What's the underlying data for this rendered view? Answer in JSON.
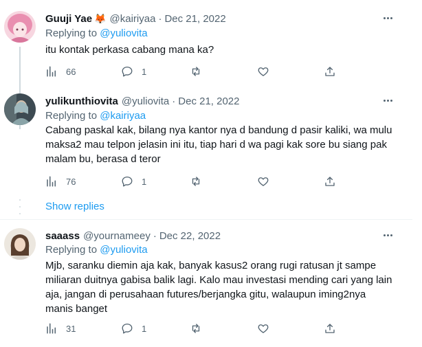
{
  "tweets": [
    {
      "name": "Guuji Yae",
      "emoji": "🦊",
      "handle": "@kairiyaa",
      "dot": "·",
      "date": "Dec 21, 2022",
      "replying_prefix": "Replying to",
      "replying_to": "@yuliovita",
      "lines": [
        "itu kontak perkasa cabang mana ka?"
      ],
      "views": "66",
      "replies": "1",
      "avatar_colors": [
        "#f4c6d3",
        "#e98fb0"
      ]
    },
    {
      "name": "yulikunthiovita",
      "emoji": "",
      "handle": "@yuliovita",
      "dot": "·",
      "date": "Dec 21, 2022",
      "replying_prefix": "Replying to",
      "replying_to": "@kairiyaa",
      "lines": [
        "Cabang paskal kak, bilang nya kantor nya d bandung d pasir kaliki, wa mulu",
        "maksa2 mau telpon jelasin ini itu, tiap hari d wa pagi kak sore bu siang pak",
        "malam bu, berasa d teror"
      ],
      "views": "76",
      "replies": "1",
      "avatar_colors": [
        "#2f3e46",
        "#8fa3a8"
      ]
    },
    {
      "name": "saaass",
      "emoji": "",
      "handle": "@yournameey",
      "dot": "·",
      "date": "Dec 22, 2022",
      "replying_prefix": "Replying to",
      "replying_to": "@yuliovita",
      "lines": [
        "Mjb, saranku diemin aja kak, banyak kasus2 orang rugi ratusan jt sampe",
        "miliaran duitnya gabisa balik lagi. Kalo mau investasi mending cari yang lain",
        "aja, jangan di perusahaan futures/berjangka gitu, walaupun iming2nya",
        "manis banget"
      ],
      "views": "31",
      "replies": "1",
      "avatar_colors": [
        "#e9e4da",
        "#7a5a44"
      ]
    }
  ],
  "show_replies": "Show replies",
  "colors": {
    "text": "#0f1419",
    "secondary": "#536471",
    "link": "#1d9bf0",
    "divider": "#eff3f4",
    "thread_line": "#cfd9de"
  },
  "icons": [
    "more-icon",
    "views-icon",
    "reply-icon",
    "retweet-icon",
    "like-icon",
    "share-icon"
  ]
}
